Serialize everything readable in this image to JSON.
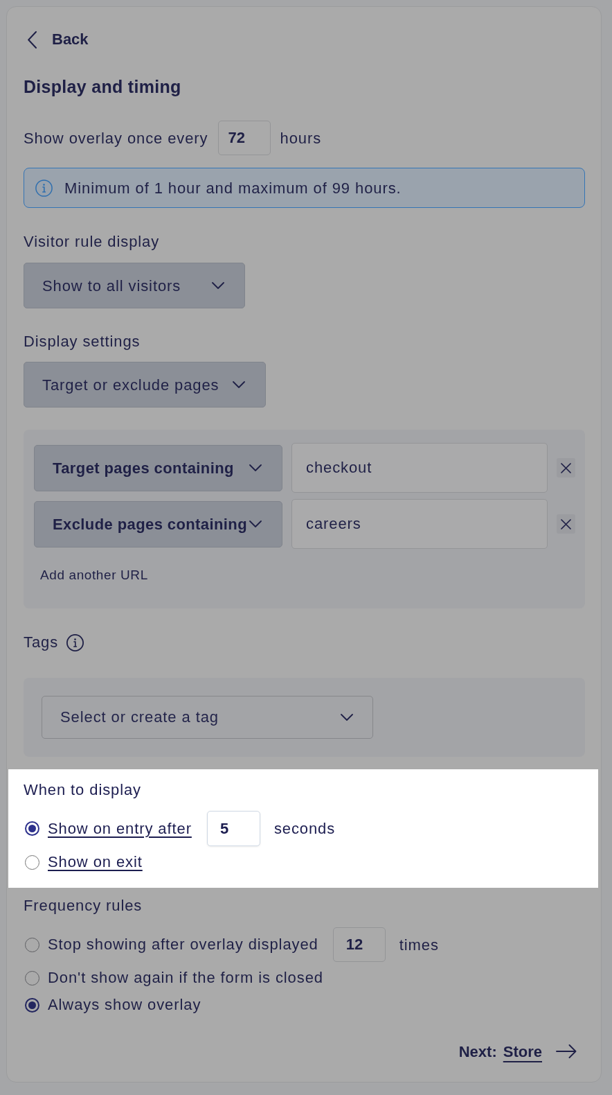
{
  "back_link": {
    "label": "Back"
  },
  "title": "Display and timing",
  "interval": {
    "prefix": "Show overlay once every",
    "value": "72",
    "suffix": "hours"
  },
  "info_banner": {
    "text": "Minimum of 1 hour and maximum of 99 hours."
  },
  "visitor_rule": {
    "label": "Visitor rule display",
    "dropdown": "Show to all visitors"
  },
  "display_settings": {
    "label": "Display settings",
    "dropdown": "Target or exclude pages",
    "url_rules": [
      {
        "match": "Target pages containing",
        "value": "checkout"
      },
      {
        "match": "Exclude pages containing",
        "value": "careers"
      }
    ],
    "add_link": "Add another URL"
  },
  "tags": {
    "label": "Tags",
    "placeholder": "Select or create a tag"
  },
  "when_to_display": {
    "label": "When to display",
    "highlighted": true,
    "options": [
      {
        "label": "Show on entry after",
        "selected": true,
        "value": "5",
        "suffix": "seconds"
      },
      {
        "label": "Show on exit",
        "selected": false
      }
    ]
  },
  "frequency_rules": {
    "label": "Frequency rules",
    "options": [
      {
        "label": "Stop showing after overlay displayed",
        "selected": false,
        "value": "12",
        "suffix": "times"
      },
      {
        "label": "Don't show again if the form is closed",
        "selected": false
      },
      {
        "label": "Always show overlay",
        "selected": true
      }
    ]
  },
  "next_link": {
    "prefix": "Next:",
    "label": "Store"
  }
}
